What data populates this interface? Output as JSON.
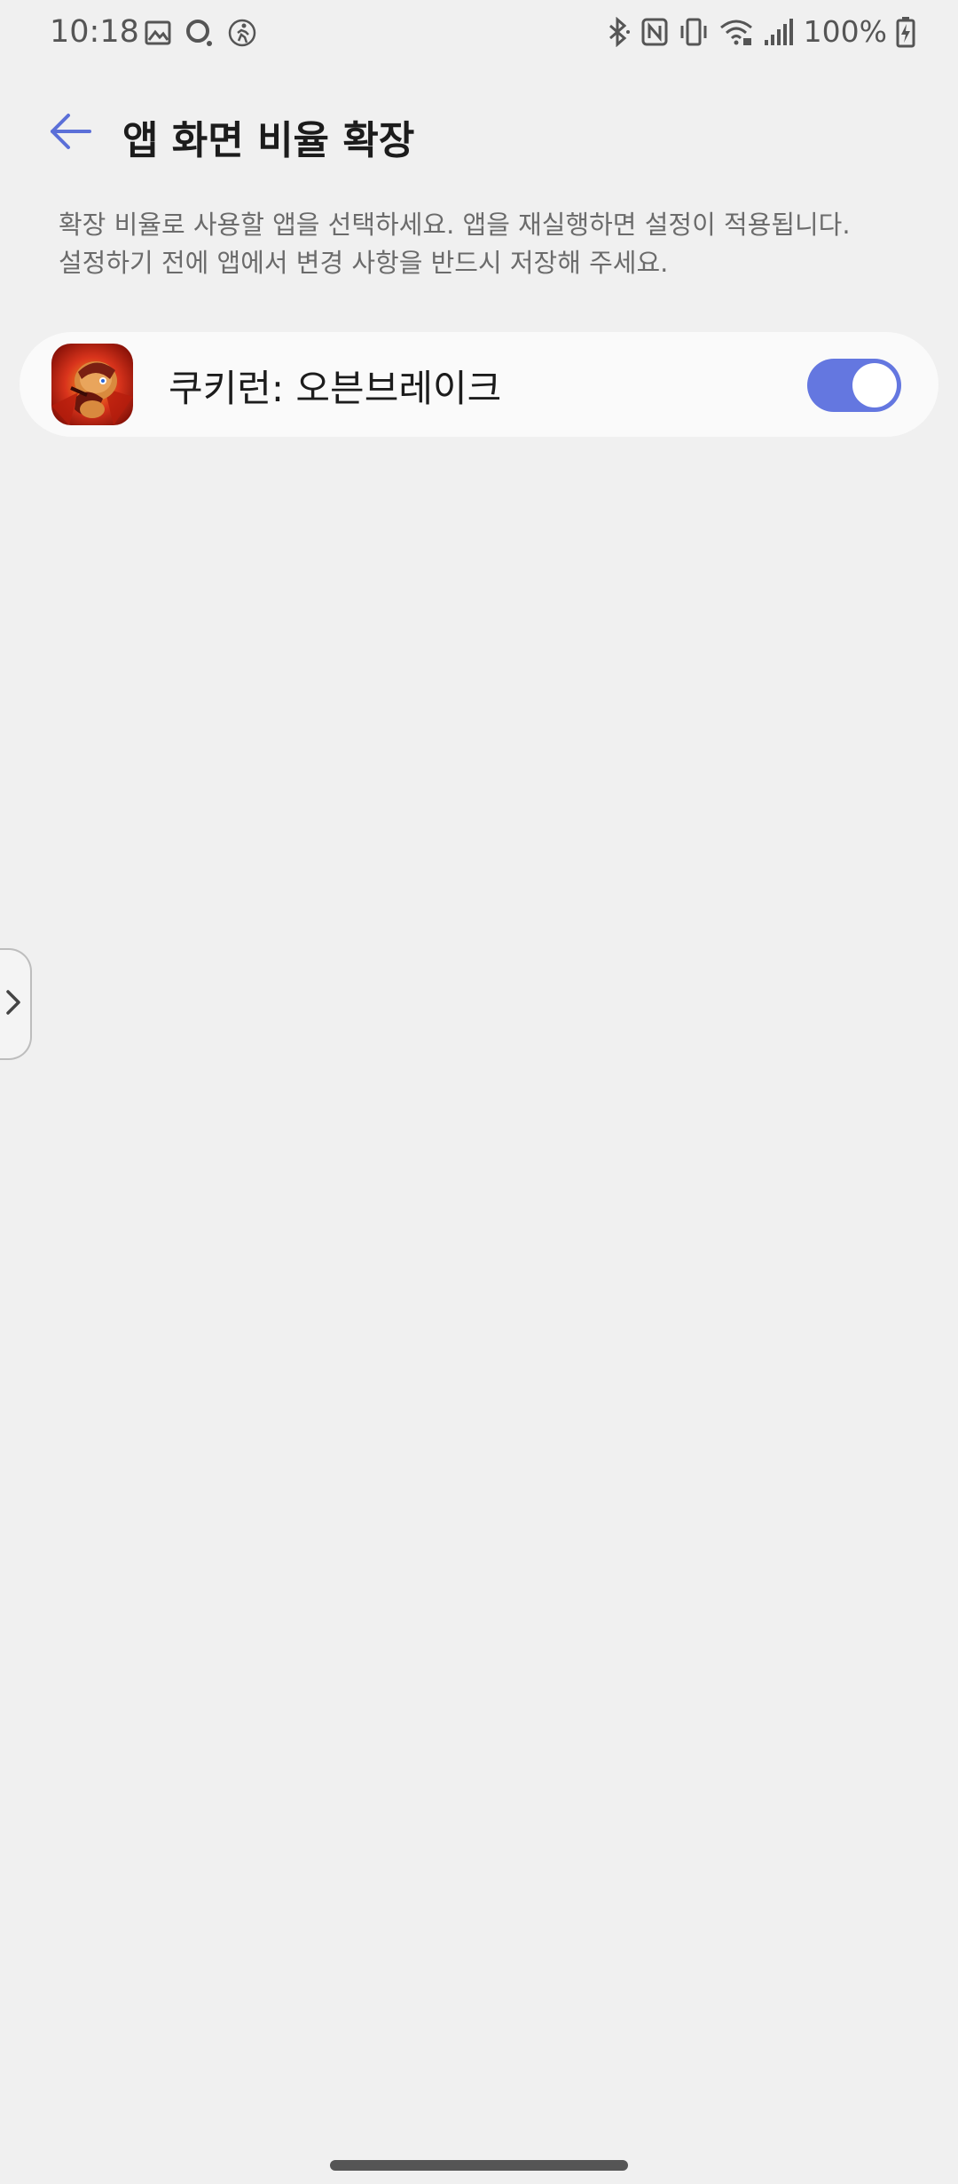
{
  "status_bar": {
    "time": "10:18",
    "left_icons": [
      "gallery-icon",
      "search-circle-icon",
      "activity-icon"
    ],
    "right_icons": [
      "bluetooth-icon",
      "nfc-icon",
      "vibrate-icon",
      "wifi-icon",
      "signal-icon"
    ],
    "battery": "100%",
    "battery_icon": "battery-charging-icon"
  },
  "header": {
    "back_icon": "back-arrow-icon",
    "title": "앱 화면 비율 확장"
  },
  "description": {
    "line1": "확장 비율로 사용할 앱을 선택하세요. 앱을 재실행하면 설정이 적용됩니다.",
    "line2": "설정하기 전에 앱에서 변경 사항을 반드시 저장해 주세요."
  },
  "apps": [
    {
      "name": "쿠키런: 오븐브레이크",
      "enabled": true
    }
  ],
  "colors": {
    "accent": "#6477e0",
    "background": "#f0f0f0",
    "card": "#fafafa"
  }
}
